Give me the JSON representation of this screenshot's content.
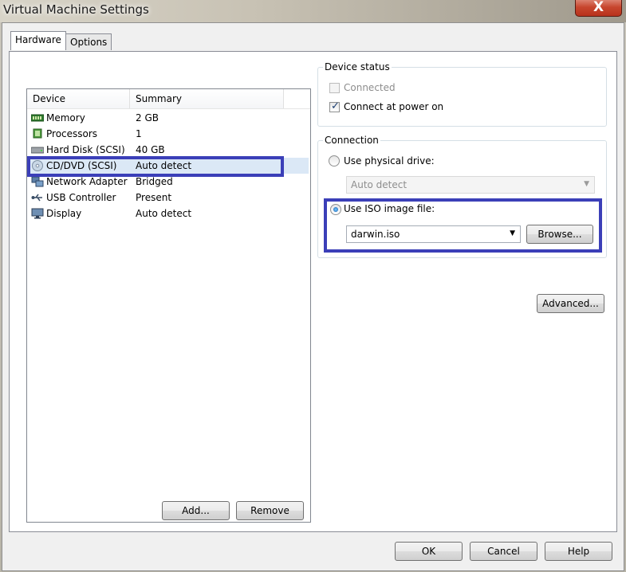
{
  "window": {
    "title": "Virtual Machine Settings",
    "close_glyph": "X"
  },
  "tabs": [
    {
      "label": "Hardware"
    },
    {
      "label": "Options"
    }
  ],
  "device_list": {
    "columns": [
      "Device",
      "Summary"
    ],
    "rows": [
      {
        "device": "Memory",
        "summary": "2 GB",
        "icon": "memory-icon"
      },
      {
        "device": "Processors",
        "summary": "1",
        "icon": "processor-icon"
      },
      {
        "device": "Hard Disk (SCSI)",
        "summary": "40 GB",
        "icon": "hard-disk-icon"
      },
      {
        "device": "CD/DVD (SCSI)",
        "summary": "Auto detect",
        "icon": "cd-dvd-icon",
        "selected": true
      },
      {
        "device": "Network Adapter",
        "summary": "Bridged",
        "icon": "network-adapter-icon"
      },
      {
        "device": "USB Controller",
        "summary": "Present",
        "icon": "usb-icon"
      },
      {
        "device": "Display",
        "summary": "Auto detect",
        "icon": "display-icon"
      }
    ],
    "add_label": "Add...",
    "remove_label": "Remove"
  },
  "device_status": {
    "title": "Device status",
    "connected_label": "Connected",
    "connected_checked": false,
    "connect_power_label": "Connect at power on",
    "connect_power_checked": true
  },
  "connection": {
    "title": "Connection",
    "physical_label": "Use physical drive:",
    "physical_value": "Auto detect",
    "iso_label": "Use ISO image file:",
    "iso_value": "darwin.iso",
    "browse_label": "Browse...",
    "selected": "iso"
  },
  "advanced_label": "Advanced...",
  "footer": {
    "ok_label": "OK",
    "cancel_label": "Cancel",
    "help_label": "Help"
  },
  "colors": {
    "highlight": "#3b3fb8",
    "selection": "#dbe8f6"
  }
}
